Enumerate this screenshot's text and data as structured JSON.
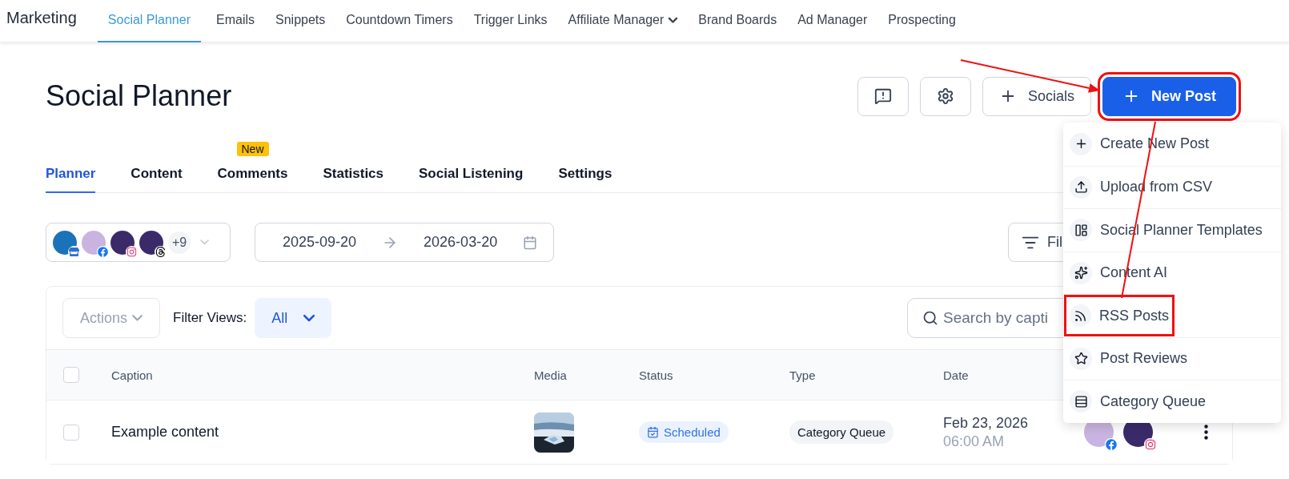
{
  "top_nav": {
    "title": "Marketing",
    "items": [
      {
        "label": "Social Planner",
        "selected": true,
        "kind": "link"
      },
      {
        "label": "Emails",
        "selected": false,
        "kind": "link"
      },
      {
        "label": "Snippets",
        "selected": false,
        "kind": "link"
      },
      {
        "label": "Countdown Timers",
        "selected": false,
        "kind": "link"
      },
      {
        "label": "Trigger Links",
        "selected": false,
        "kind": "link"
      },
      {
        "label": "Affiliate Manager",
        "selected": false,
        "kind": "dropdown"
      },
      {
        "label": "Brand Boards",
        "selected": false,
        "kind": "link"
      },
      {
        "label": "Ad Manager",
        "selected": false,
        "kind": "link"
      },
      {
        "label": "Prospecting",
        "selected": false,
        "kind": "link"
      }
    ]
  },
  "header": {
    "title": "Social Planner",
    "actions": [
      {
        "kind": "feedback",
        "highlighted": false
      },
      {
        "kind": "settings",
        "highlighted": false
      },
      {
        "kind": "outline",
        "label": "Socials",
        "highlighted": false
      },
      {
        "kind": "primary",
        "label": "New Post",
        "highlighted": true
      }
    ]
  },
  "tabs": [
    {
      "label": "Planner",
      "selected": true
    },
    {
      "label": "Content",
      "selected": false
    },
    {
      "label": "Comments",
      "selected": false,
      "badge": "New"
    },
    {
      "label": "Statistics",
      "selected": false
    },
    {
      "label": "Social Listening",
      "selected": false
    },
    {
      "label": "Settings",
      "selected": false
    }
  ],
  "filters": {
    "accounts": [
      {
        "kind": "business"
      },
      {
        "kind": "facebook"
      },
      {
        "kind": "instagram"
      },
      {
        "kind": "threads"
      }
    ],
    "more_count": "+9",
    "date_start": "2025-09-20",
    "date_end": "2026-03-20",
    "filter_button": "Fil"
  },
  "table": {
    "toolbar": {
      "actions": {
        "label": "Actions",
        "disabled": true
      },
      "filter_views_label": "Filter Views:",
      "filter_views_value": "All",
      "search_placeholder": "Search by capti"
    },
    "select_all_checked": false,
    "columns": [
      "Caption",
      "Media",
      "Status",
      "Type",
      "Date"
    ],
    "rows": [
      {
        "checked": false,
        "caption": "Example content",
        "status": "Scheduled",
        "type": "Category Queue",
        "date": "Feb 23, 2026",
        "time": "06:00 AM",
        "accounts": [
          {
            "kind": "facebook"
          },
          {
            "kind": "instagram"
          }
        ]
      }
    ]
  },
  "menu": {
    "items": [
      {
        "kind": "plus",
        "label": "Create New Post",
        "highlighted": false
      },
      {
        "kind": "upload",
        "label": "Upload from CSV",
        "highlighted": false
      },
      {
        "kind": "templates",
        "label": "Social Planner Templates",
        "highlighted": false
      },
      {
        "kind": "ai",
        "label": "Content AI",
        "highlighted": false
      },
      {
        "kind": "rss",
        "label": "RSS Posts",
        "highlighted": true
      },
      {
        "kind": "star",
        "label": "Post Reviews",
        "highlighted": false
      },
      {
        "kind": "queue",
        "label": "Category Queue",
        "highlighted": false
      }
    ]
  },
  "annotations": [
    {
      "kind": "arrow"
    },
    {
      "kind": "line"
    }
  ]
}
